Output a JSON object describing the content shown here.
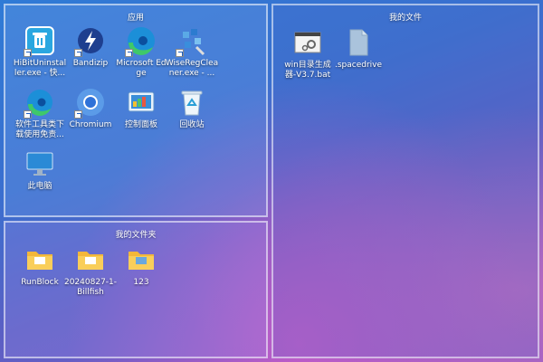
{
  "fences": {
    "apps": {
      "title": "应用",
      "icons": [
        {
          "label": "HiBitUninstaller.exe - 快..."
        },
        {
          "label": "Bandizip"
        },
        {
          "label": "Microsoft Edge"
        },
        {
          "label": "WiseRegCleaner.exe - ..."
        },
        {
          "label": "软件工具类下载使用免责..."
        },
        {
          "label": "Chromium"
        },
        {
          "label": "控制面板"
        },
        {
          "label": "回收站"
        },
        {
          "label": "此电脑"
        }
      ]
    },
    "folders": {
      "title": "我的文件夹",
      "icons": [
        {
          "label": "RunBlock"
        },
        {
          "label": "20240827-1-Billfish"
        },
        {
          "label": "123"
        }
      ]
    },
    "files": {
      "title": "我的文件",
      "icons": [
        {
          "label": "win目录生成器-V3.7.bat"
        },
        {
          "label": ".spacedrive"
        }
      ]
    }
  }
}
